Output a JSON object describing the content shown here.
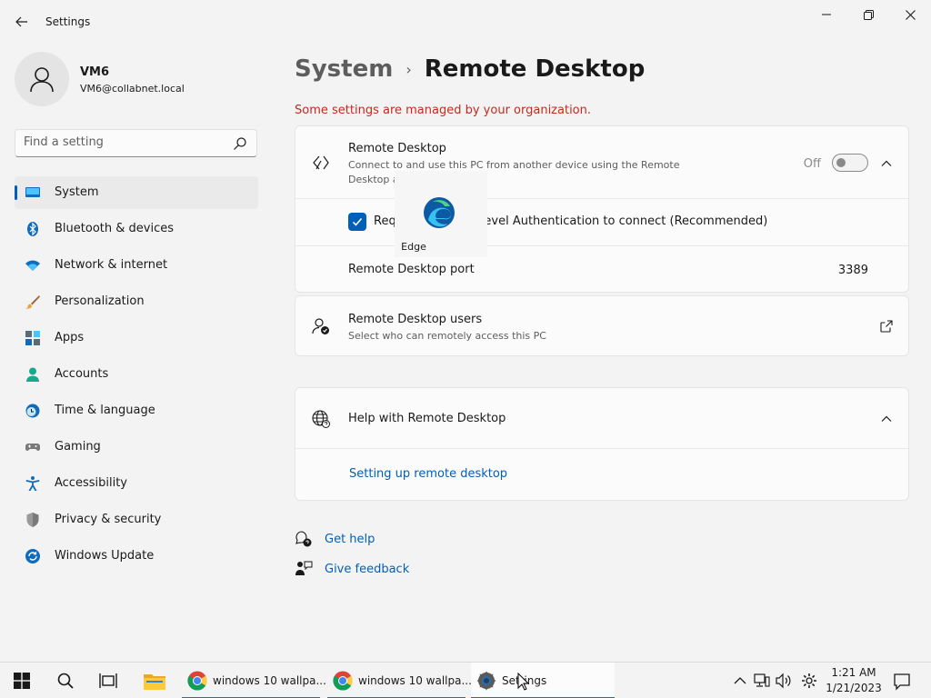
{
  "window": {
    "title": "Settings"
  },
  "profile": {
    "name": "VM6",
    "email": "VM6@collabnet.local"
  },
  "search": {
    "placeholder": "Find a setting"
  },
  "sidebar": {
    "items": [
      {
        "label": "System",
        "icon": "monitor-icon",
        "selected": true
      },
      {
        "label": "Bluetooth & devices",
        "icon": "bluetooth-icon"
      },
      {
        "label": "Network & internet",
        "icon": "wifi-icon"
      },
      {
        "label": "Personalization",
        "icon": "brush-icon"
      },
      {
        "label": "Apps",
        "icon": "apps-icon"
      },
      {
        "label": "Accounts",
        "icon": "person-icon"
      },
      {
        "label": "Time & language",
        "icon": "clock-globe-icon"
      },
      {
        "label": "Gaming",
        "icon": "gamepad-icon"
      },
      {
        "label": "Accessibility",
        "icon": "accessibility-icon"
      },
      {
        "label": "Privacy & security",
        "icon": "shield-icon"
      },
      {
        "label": "Windows Update",
        "icon": "update-icon"
      }
    ]
  },
  "breadcrumb": {
    "parent": "System",
    "separator": "›",
    "current": "Remote Desktop"
  },
  "managed_notice": "Some settings are managed by your organization.",
  "remote_desktop": {
    "title": "Remote Desktop",
    "description_line1": "Connect to and use this PC from another device using the Remote",
    "description_line2": "Desktop a",
    "toggle_state": "Off",
    "nla_label": "Req                        use Network Level Authentication to connect (Recommended)",
    "port_label": "Remote Desktop port",
    "port_value": "3389"
  },
  "edge_popup": {
    "label": "Edge"
  },
  "users": {
    "title": "Remote Desktop users",
    "description": "Select who can remotely access this PC"
  },
  "help": {
    "title": "Help with Remote Desktop",
    "link": "Setting up remote desktop"
  },
  "footer_links": {
    "get_help": "Get help",
    "give_feedback": "Give feedback"
  },
  "taskbar": {
    "apps": [
      {
        "label": "windows 10 wallpa...",
        "icon": "chrome-icon"
      },
      {
        "label": "windows 10 wallpa...",
        "icon": "chrome-icon"
      },
      {
        "label": "Settings",
        "icon": "settings-gear-icon",
        "active": true
      }
    ],
    "time": "1:21 AM",
    "date": "1/21/2023"
  },
  "colors": {
    "accent": "#005fb8",
    "warning_text": "#c42b1c",
    "taskbar_indicator": "#0078d4"
  }
}
